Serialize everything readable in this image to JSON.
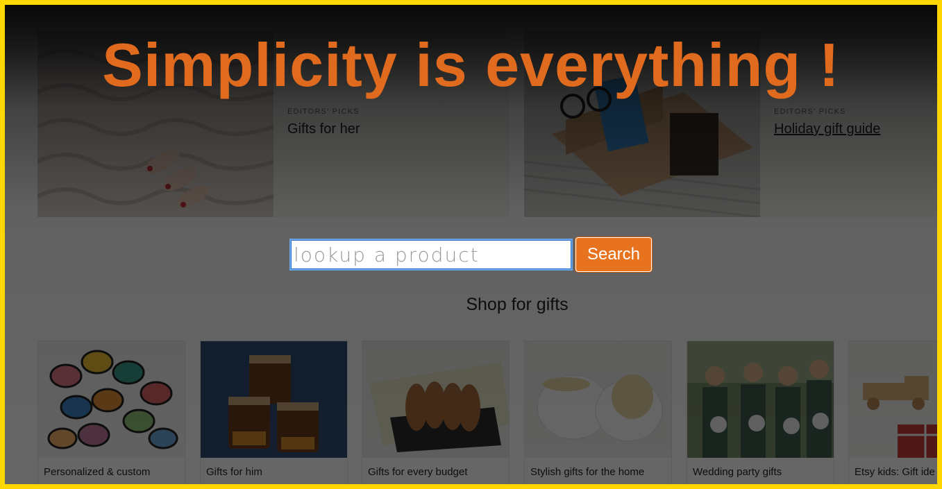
{
  "headline": "Simplicity is everything !",
  "features": [
    {
      "kicker": "Editors' picks",
      "title": "Gifts for her"
    },
    {
      "kicker": "Editors' picks",
      "title": "Holiday gift guide"
    }
  ],
  "search": {
    "placeholder": "lookup a product",
    "button_label": "Search"
  },
  "section_heading": "Shop for gifts",
  "tiles": [
    {
      "label": "Personalized & custom",
      "icon": "embroidered-patches-image"
    },
    {
      "label": "Gifts for him",
      "icon": "candle-jars-image"
    },
    {
      "label": "Gifts for every budget",
      "icon": "cookies-image"
    },
    {
      "label": "Stylish gifts for the home",
      "icon": "ceramic-bowls-image"
    },
    {
      "label": "Wedding party gifts",
      "icon": "bridesmaids-image"
    },
    {
      "label": "Etsy kids: Gift ide",
      "icon": "wooden-toy-image"
    }
  ],
  "colors": {
    "frame": "#ffd700",
    "accent": "#e06a1e",
    "button": "#e8731f",
    "input_focus": "#6aa6e8"
  }
}
